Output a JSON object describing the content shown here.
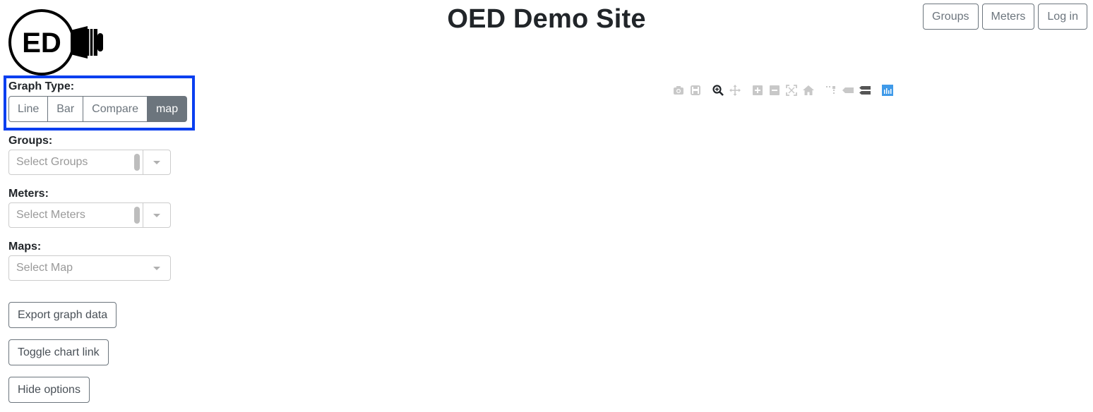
{
  "header": {
    "title": "OED Demo Site",
    "logo_text": "ED"
  },
  "nav": {
    "groups_label": "Groups",
    "meters_label": "Meters",
    "login_label": "Log in"
  },
  "graph_type": {
    "label": "Graph Type:",
    "options": [
      "Line",
      "Bar",
      "Compare",
      "map"
    ],
    "selected": "map"
  },
  "groups": {
    "label": "Groups:",
    "placeholder": "Select Groups"
  },
  "meters": {
    "label": "Meters:",
    "placeholder": "Select Meters"
  },
  "maps": {
    "label": "Maps:",
    "placeholder": "Select Map"
  },
  "actions": {
    "export_label": "Export graph data",
    "toggle_link_label": "Toggle chart link",
    "hide_options_label": "Hide options"
  },
  "modebar": {
    "icons": [
      "camera-icon",
      "save-icon",
      "zoom-icon",
      "pan-icon",
      "zoom-in-icon",
      "zoom-out-icon",
      "autoscale-icon",
      "home-icon",
      "spike-lines-icon",
      "hover-closest-icon",
      "hover-compare-icon",
      "plotly-logo-icon"
    ],
    "active_color": "#212529",
    "inactive_color": "#c8c8c8",
    "brand_color": "#3f9ae9"
  },
  "colors": {
    "highlight_border": "#0a3ff0",
    "button_gray": "#6c757d"
  }
}
